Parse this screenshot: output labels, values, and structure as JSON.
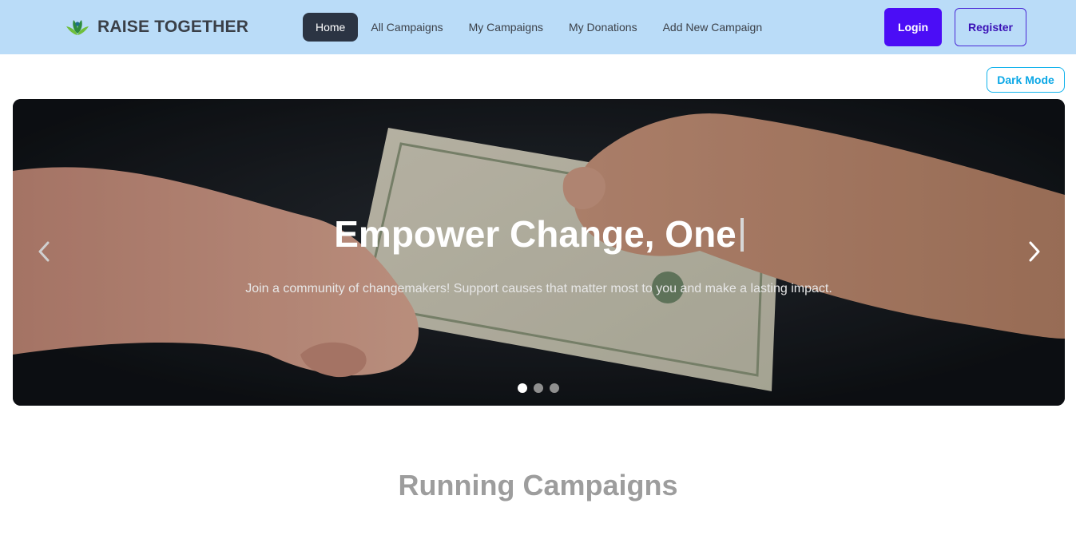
{
  "brand": {
    "name": "RAISE TOGETHER",
    "logo_icon": "leaf-logo-icon"
  },
  "nav": {
    "links": [
      {
        "label": "Home",
        "active": true
      },
      {
        "label": "All Campaigns",
        "active": false
      },
      {
        "label": "My Campaigns",
        "active": false
      },
      {
        "label": "My Donations",
        "active": false
      },
      {
        "label": "Add New Campaign",
        "active": false
      }
    ],
    "login_label": "Login",
    "register_label": "Register"
  },
  "theme": {
    "dark_mode_label": "Dark Mode"
  },
  "hero": {
    "title": "Empower Change, One",
    "subtitle": "Join a community of changemakers! Support causes that matter most to you and make a lasting impact.",
    "slides_total": 3,
    "active_slide": 1,
    "prev_icon": "chevron-left-icon",
    "next_icon": "chevron-right-icon"
  },
  "sections": {
    "running_title": "Running Campaigns"
  },
  "colors": {
    "navbar_bg": "#badcf8",
    "login_bg": "#4b0df6",
    "register_text": "#3b11b6",
    "dark_mode_accent": "#0aa7e6",
    "active_nav_bg": "#2b3443"
  }
}
